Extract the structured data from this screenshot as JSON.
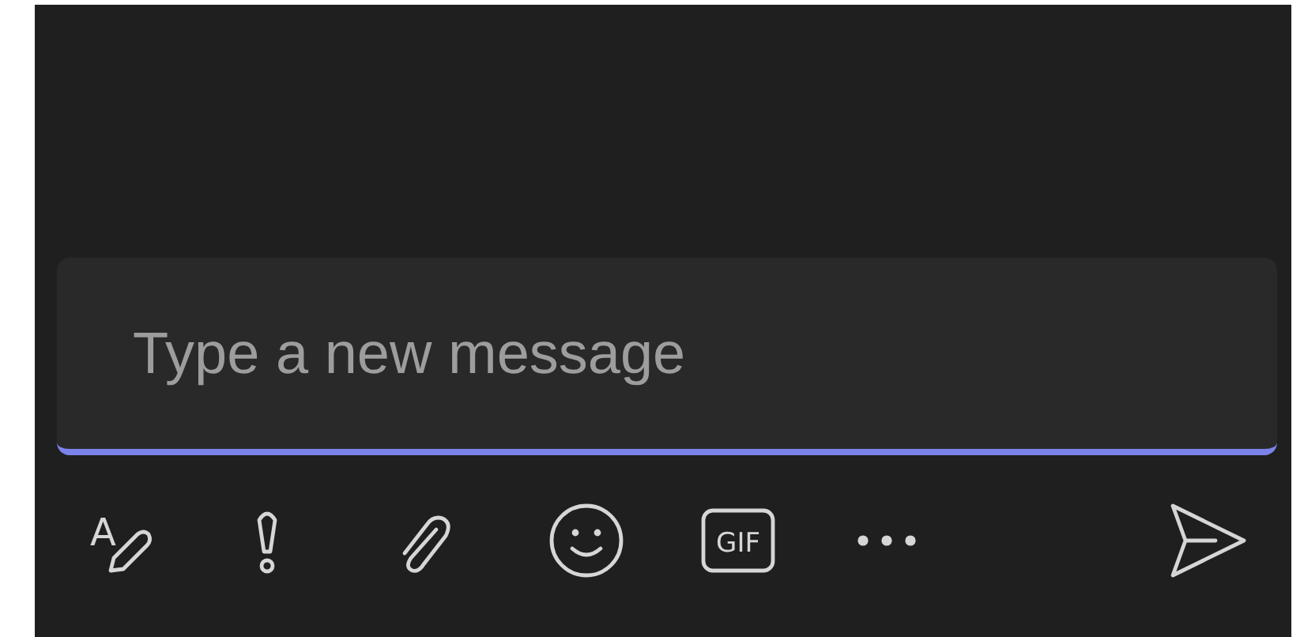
{
  "compose": {
    "placeholder": "Type a new message",
    "focused": true
  },
  "toolbar": [
    {
      "kind": "format",
      "label": "A"
    },
    {
      "kind": "important"
    },
    {
      "kind": "attach"
    },
    {
      "kind": "emoji"
    },
    {
      "kind": "gif",
      "label": "GIF"
    },
    {
      "kind": "more"
    },
    {
      "kind": "send"
    }
  ]
}
